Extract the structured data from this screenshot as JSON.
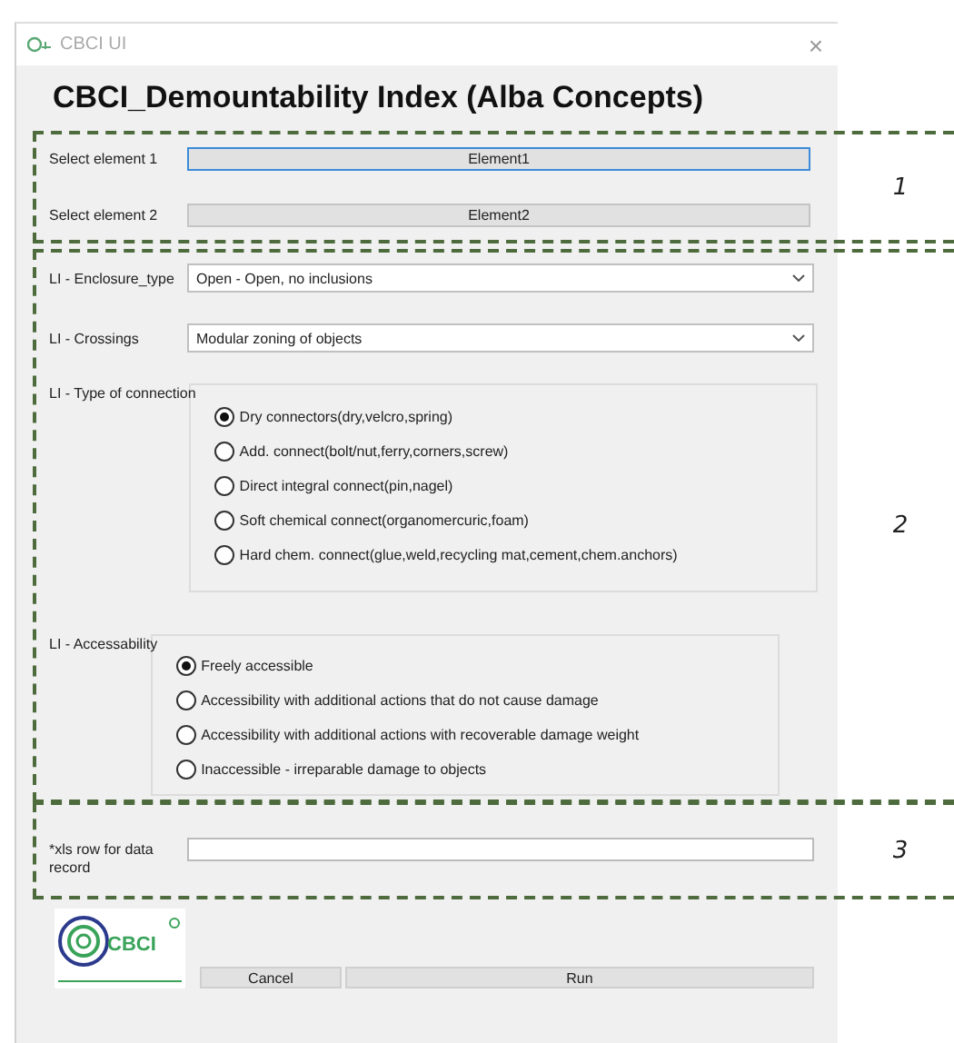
{
  "window": {
    "title": "CBCI UI",
    "close": "×"
  },
  "heading": "CBCI_Demountability Index (Alba Concepts)",
  "element_selectors": [
    {
      "label": "Select element 1",
      "button": "Element1",
      "focused": true
    },
    {
      "label": "Select element 2",
      "button": "Element2",
      "focused": false
    }
  ],
  "dropdowns": [
    {
      "label": "LI - Enclosure_type",
      "value": "Open - Open, no inclusions"
    },
    {
      "label": "LI - Crossings",
      "value": "Modular zoning of objects"
    }
  ],
  "radio_groups": [
    {
      "label": "LI - Type of connection",
      "options": [
        {
          "label": "Dry connectors(dry,velcro,spring)",
          "selected": true
        },
        {
          "label": "Add. connect(bolt/nut,ferry,corners,screw)",
          "selected": false
        },
        {
          "label": "Direct integral connect(pin,nagel)",
          "selected": false
        },
        {
          "label": "Soft chemical connect(organomercuric,foam)",
          "selected": false
        },
        {
          "label": "Hard chem. connect(glue,weld,recycling mat,cement,chem.anchors)",
          "selected": false
        }
      ]
    },
    {
      "label": "LI - Accessability",
      "options": [
        {
          "label": "Freely accessible",
          "selected": true
        },
        {
          "label": "Accessibility with additional actions that do not cause damage",
          "selected": false
        },
        {
          "label": "Accessibility with additional actions with recoverable damage weight",
          "selected": false
        },
        {
          "label": "Inaccessible - irreparable damage to objects",
          "selected": false
        }
      ]
    }
  ],
  "xls_row": {
    "label": "*xls row for data record"
  },
  "logo": {
    "text": "CBCI"
  },
  "buttons": [
    "Cancel",
    "Run"
  ],
  "annotations": [
    "1",
    "2",
    "3"
  ]
}
